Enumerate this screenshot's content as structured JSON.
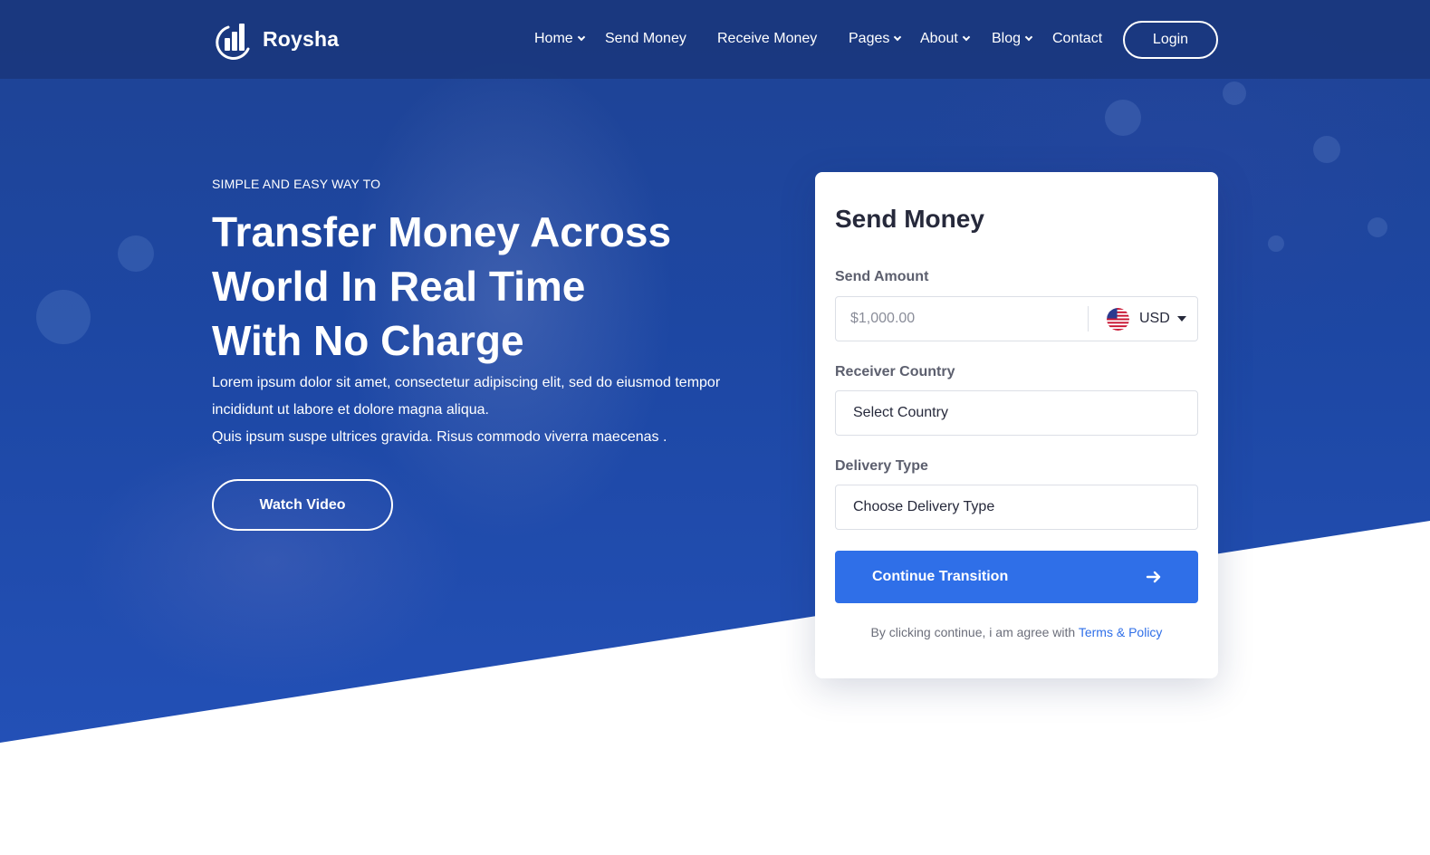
{
  "brand": {
    "name": "Roysha",
    "logo_icon": "bar-chart-arc-icon"
  },
  "nav": {
    "items": [
      {
        "label": "Home",
        "has_dropdown": true
      },
      {
        "label": "Send Money",
        "has_dropdown": false
      },
      {
        "label": "Receive Money",
        "has_dropdown": false
      },
      {
        "label": "Pages",
        "has_dropdown": true
      },
      {
        "label": "About",
        "has_dropdown": true
      },
      {
        "label": "Blog",
        "has_dropdown": true
      },
      {
        "label": "Contact",
        "has_dropdown": false
      }
    ],
    "login_label": "Login"
  },
  "hero": {
    "eyebrow": "SIMPLE AND EASY WAY TO",
    "headline_lines": [
      "Transfer Money Across",
      "World In Real Time",
      "With No Charge"
    ],
    "lead_lines": [
      "Lorem ipsum dolor sit amet, consectetur adipiscing elit, sed do eiusmod tempor",
      "incididunt ut labore et dolore magna aliqua.",
      "Quis ipsum suspe ultrices gravida. Risus commodo viverra maecenas ."
    ],
    "watch_video_label": "Watch Video"
  },
  "send_form": {
    "title": "Send Money",
    "amount_label": "Send Amount",
    "amount_placeholder": "$1,000.00",
    "currency": {
      "code": "USD",
      "flag_icon": "us-flag-icon"
    },
    "receiver_label": "Receiver Country",
    "receiver_value": "Select Country",
    "delivery_label": "Delivery Type",
    "delivery_value": "Choose Delivery Type",
    "continue_label": "Continue Transition",
    "terms_text": "By clicking continue, i am agree with ",
    "terms_link": "Terms & Policy"
  },
  "colors": {
    "hero_blue": "#1d47a3",
    "accent": "#2f6fe8",
    "text_dark": "#26293b",
    "label_gray": "#5c5f6e"
  }
}
